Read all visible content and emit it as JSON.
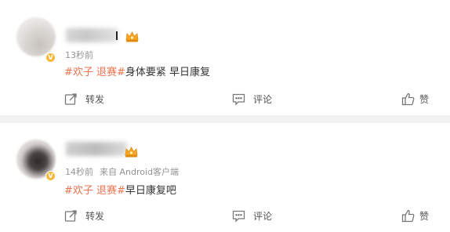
{
  "posts": [
    {
      "username": "",
      "time": "13秒前",
      "source": "",
      "tags": [
        "#欢子 退赛#"
      ],
      "body": "身体要紧 早日康复",
      "actions": {
        "repost": "转发",
        "comment": "评论",
        "like": "赞"
      }
    },
    {
      "username": "",
      "time": "14秒前",
      "source": "来自 Android客户端",
      "tags": [
        "#欢子 退赛#"
      ],
      "body": "早日康复吧",
      "actions": {
        "repost": "转发",
        "comment": "评论",
        "like": "赞"
      }
    }
  ],
  "icons": {
    "repost": "share-arrow-icon",
    "comment": "comment-icon",
    "like": "thumbs-up-icon",
    "verified": "verified-badge-icon",
    "member": "crown-icon"
  },
  "colors": {
    "tag": "#eb7350",
    "meta": "#939393",
    "verified": "#f6b93b",
    "background": "#f2f2f2"
  }
}
